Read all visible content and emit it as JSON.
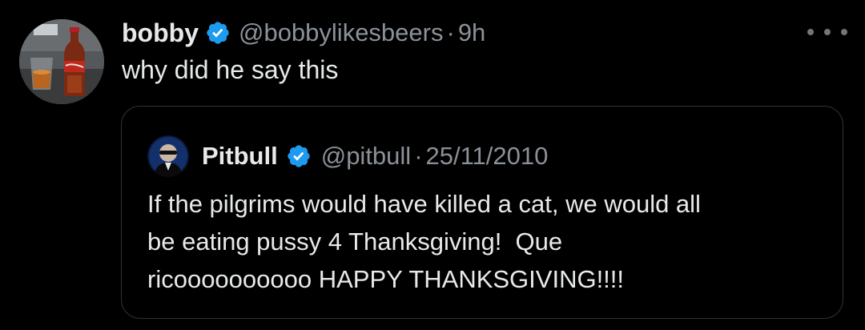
{
  "tweet": {
    "author_name": "bobby",
    "author_handle": "@bobbylikesbeers",
    "separator": "·",
    "time": "9h",
    "text": "why did he say this",
    "more_icon": "more-horizontal-icon"
  },
  "quoted_tweet": {
    "author_name": "Pitbull",
    "author_handle": "@pitbull",
    "separator": "·",
    "date": "25/11/2010",
    "text_lines": [
      "If the pilgrims would have killed a cat, we would all",
      "be eating pussy 4 Thanksgiving!  Que",
      "ricoooooooooo HAPPY THANKSGIVING!!!!"
    ]
  },
  "colors": {
    "background": "#000000",
    "text": "#e7e9ea",
    "secondary_text": "#8b9198",
    "verified_badge": "#1d9bf0",
    "quote_border": "#2f3336"
  }
}
